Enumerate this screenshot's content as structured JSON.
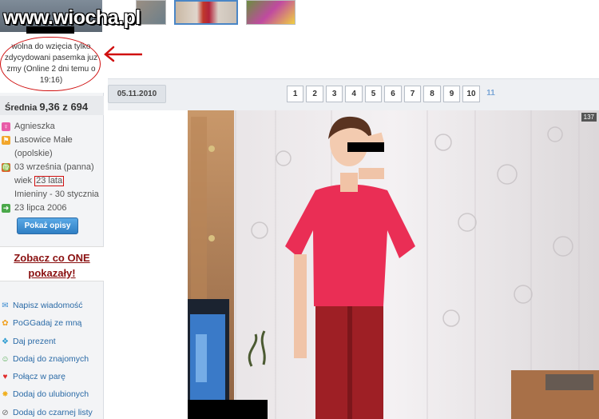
{
  "watermark": "www.wiocha.pl",
  "status": {
    "lines": [
      "wolna do wzięcia tylko",
      "zdycydowani pasemka juz",
      "zmy (Online 2 dni temu o",
      "19:16)"
    ]
  },
  "rating": {
    "label": "Średnia",
    "value": "9,36 z 694"
  },
  "info": {
    "name": "Agnieszka",
    "place": "Lasowice Małe",
    "region": "(opolskie)",
    "birth": "03 września (panna)",
    "age_prefix": "wiek",
    "age": "23 lata",
    "nameday": "Imieniny - 30 stycznia",
    "joined": "23 lipca 2006"
  },
  "buttons": {
    "show_descriptions": "Pokaż opisy"
  },
  "promo": {
    "line1": "Zobacz co ONE",
    "line2": "pokazały!"
  },
  "actions": [
    {
      "label": "Napisz wiadomość",
      "icon": "envelope-icon"
    },
    {
      "label": "PoGGadaj ze mną",
      "icon": "flower-icon"
    },
    {
      "label": "Daj prezent",
      "icon": "gift-icon"
    },
    {
      "label": "Dodaj do znajomych",
      "icon": "add-friend-icon"
    },
    {
      "label": "Połącz w parę",
      "icon": "heart-icon"
    },
    {
      "label": "Dodaj do ulubionych",
      "icon": "star-icon"
    },
    {
      "label": "Dodaj do czarnej listy",
      "icon": "block-icon"
    }
  ],
  "photo": {
    "date": "05.11.2010",
    "count": "137"
  },
  "pager": {
    "pages": [
      "1",
      "2",
      "3",
      "4",
      "5",
      "6",
      "7",
      "8",
      "9",
      "10"
    ],
    "current": "11"
  },
  "colors": {
    "annotation": "#d01010",
    "link": "#2a6aa6",
    "promo": "#8a1010"
  }
}
